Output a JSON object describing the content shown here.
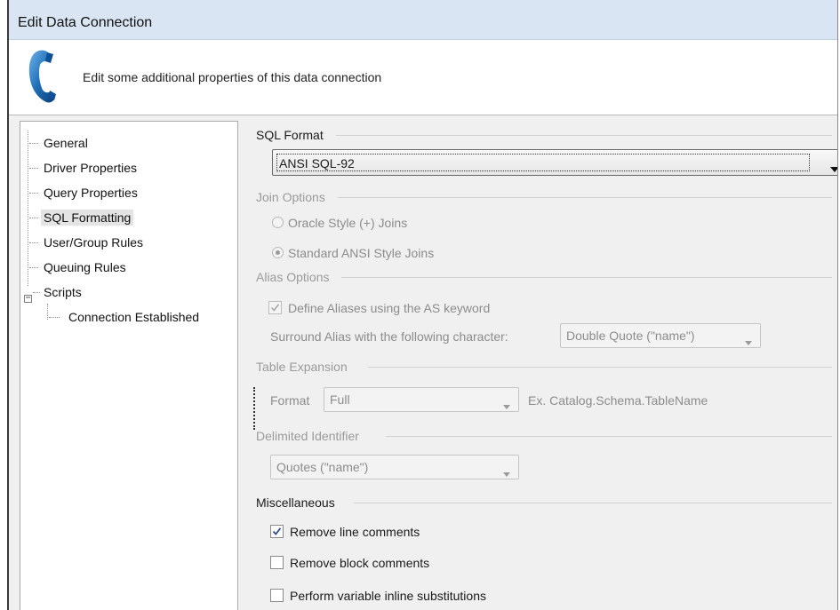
{
  "window": {
    "title": "Edit Data Connection"
  },
  "header": {
    "description": "Edit some additional properties of this data connection"
  },
  "tree": {
    "items": [
      {
        "label": "General"
      },
      {
        "label": "Driver Properties"
      },
      {
        "label": "Query Properties"
      },
      {
        "label": "SQL Formatting"
      },
      {
        "label": "User/Group Rules"
      },
      {
        "label": "Queuing Rules"
      },
      {
        "label": "Scripts"
      }
    ],
    "children": [
      {
        "label": "Connection Established"
      }
    ],
    "selected": "SQL Formatting"
  },
  "sql_format": {
    "title": "SQL Format",
    "value": "ANSI SQL-92"
  },
  "join_options": {
    "title": "Join Options",
    "oracle": "Oracle Style (+) Joins",
    "standard": "Standard ANSI Style Joins",
    "selected": "Standard ANSI Style Joins"
  },
  "alias_options": {
    "title": "Alias Options",
    "define_aliases": "Define Aliases using the AS keyword",
    "define_aliases_checked": true,
    "surround_label": "Surround Alias with the following character:",
    "surround_value": "Double Quote (\"name\")"
  },
  "table_expansion": {
    "title": "Table Expansion",
    "format_label": "Format",
    "format_value": "Full",
    "example": "Ex. Catalog.Schema.TableName"
  },
  "delimited_identifier": {
    "title": "Delimited Identifier",
    "value": "Quotes (\"name\")"
  },
  "miscellaneous": {
    "title": "Miscellaneous",
    "items": [
      {
        "label": "Remove line comments",
        "checked": true
      },
      {
        "label": "Remove block comments",
        "checked": false
      },
      {
        "label": "Perform variable inline substitutions",
        "checked": false
      }
    ]
  },
  "colors": {
    "titlebar": "#d9e5f3",
    "phone_icon": "#1f6fb7",
    "check_mark": "#2a4f8a",
    "disabled_text": "#8c8c8c"
  },
  "icons": {
    "header": "phone-icon",
    "dropdown": "chevron-down-icon",
    "expander": "collapse-icon"
  }
}
